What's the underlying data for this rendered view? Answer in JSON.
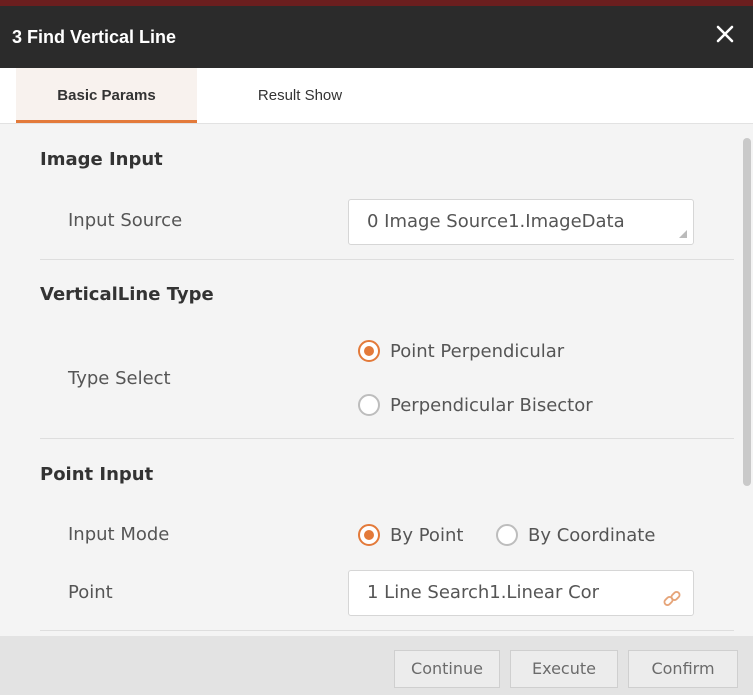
{
  "window": {
    "title": "3 Find Vertical Line",
    "close_icon": "close-icon"
  },
  "tabs": [
    {
      "label": "Basic Params",
      "active": true
    },
    {
      "label": "Result Show",
      "active": false
    }
  ],
  "image_input": {
    "section_title": "Image Input",
    "input_source_label": "Input Source",
    "input_source_value": "0 Image Source1.ImageData"
  },
  "vertical_line_type": {
    "section_title": "VerticalLine Type",
    "type_select_label": "Type Select",
    "options": [
      "Point Perpendicular",
      "Perpendicular Bisector"
    ],
    "selected": "Point Perpendicular"
  },
  "point_input": {
    "section_title": "Point Input",
    "input_mode_label": "Input Mode",
    "modes": [
      "By Point",
      "By Coordinate"
    ],
    "selected_mode": "By Point",
    "point_label": "Point",
    "point_value": "1 Line Search1.Linear Cor",
    "link_icon": "link-icon"
  },
  "footer": {
    "continue_label": "Continue",
    "execute_label": "Execute",
    "confirm_label": "Confirm"
  },
  "colors": {
    "accent": "#e37a3a",
    "titlebar": "#2b2b2b",
    "background": "#f4f4f4"
  }
}
